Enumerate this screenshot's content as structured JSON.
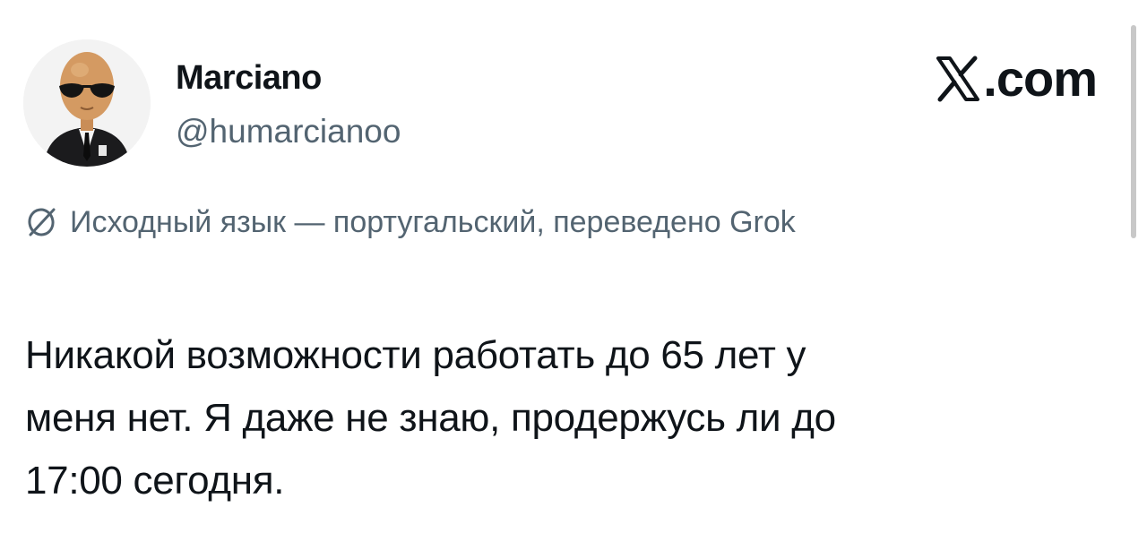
{
  "author": {
    "display_name": "Marciano",
    "handle": "@humarcianoo",
    "avatar_icon": "alien-in-suit-avatar"
  },
  "brand": {
    "label": ".com",
    "icon": "x-logo-icon"
  },
  "translation_note": {
    "icon": "globe-icon",
    "text": "Исходный язык — португальский, переведено Grok"
  },
  "tweet": {
    "lines": [
      "Никакой возможности работать до 65 лет у",
      "меня нет. Я даже не знаю, продержусь ли до",
      "17:00 сегодня."
    ]
  },
  "colors": {
    "text": "#0f1419",
    "secondary": "#536471",
    "background": "#ffffff"
  }
}
